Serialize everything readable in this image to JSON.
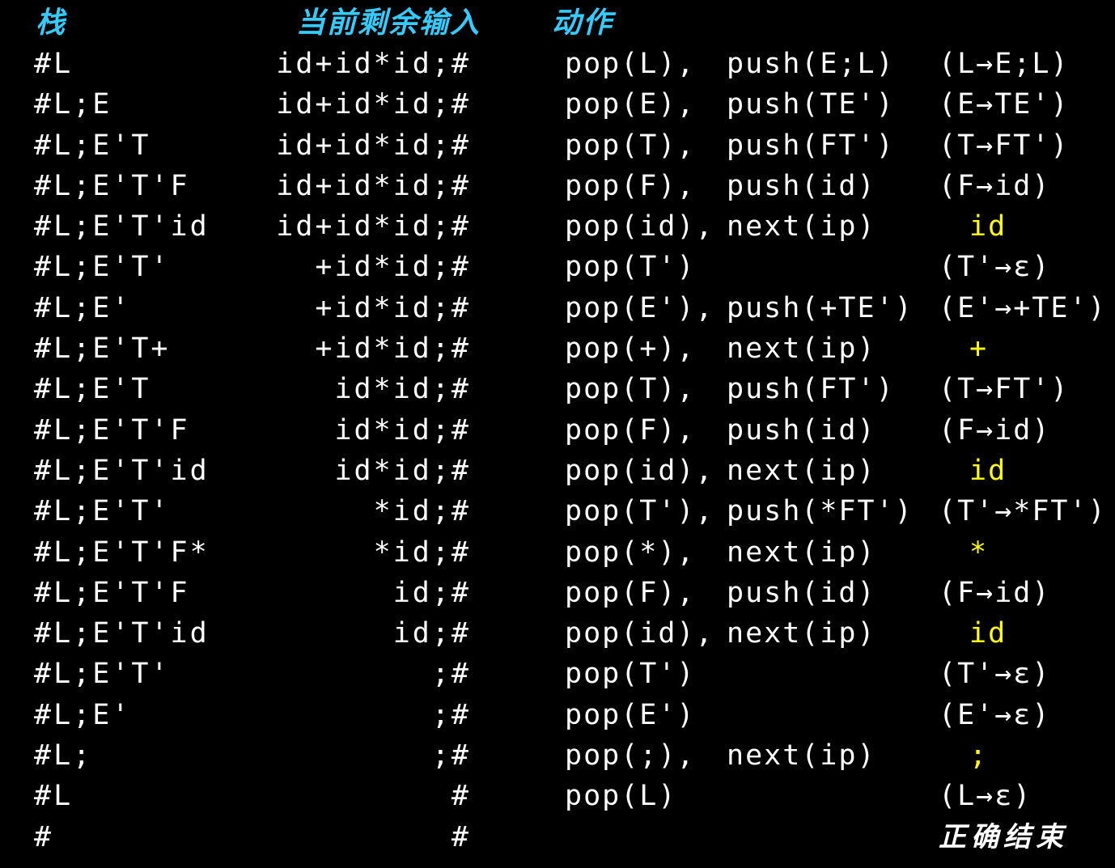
{
  "headers": {
    "stack": "栈",
    "input": "当前剩余输入",
    "action": "动作"
  },
  "rows": [
    {
      "stack": "#L",
      "input": "id+id*id;#",
      "pop": "pop(L),",
      "push": "push(E;L)",
      "note": "(L→E;L)",
      "note_color": "white"
    },
    {
      "stack": "#L;E",
      "input": "id+id*id;#",
      "pop": "pop(E),",
      "push": "push(TE')",
      "note": "(E→TE')",
      "note_color": "white"
    },
    {
      "stack": "#L;E'T",
      "input": "id+id*id;#",
      "pop": "pop(T),",
      "push": "push(FT')",
      "note": "(T→FT')",
      "note_color": "white"
    },
    {
      "stack": "#L;E'T'F",
      "input": "id+id*id;#",
      "pop": "pop(F),",
      "push": "push(id)",
      "note": "(F→id)",
      "note_color": "white"
    },
    {
      "stack": "#L;E'T'id",
      "input": "id+id*id;#",
      "pop": "pop(id),",
      "push": "next(ip)",
      "note": "id",
      "note_color": "yellow"
    },
    {
      "stack": "#L;E'T'",
      "input": "+id*id;#",
      "pop": "pop(T')",
      "push": "",
      "note": "(T'→ε)",
      "note_color": "white"
    },
    {
      "stack": "#L;E'",
      "input": "+id*id;#",
      "pop": "pop(E'),",
      "push": "push(+TE')",
      "note": "(E'→+TE')",
      "note_color": "white"
    },
    {
      "stack": "#L;E'T+",
      "input": "+id*id;#",
      "pop": "pop(+),",
      "push": "next(ip)",
      "note": "+",
      "note_color": "yellow"
    },
    {
      "stack": "#L;E'T",
      "input": "id*id;#",
      "pop": "pop(T),",
      "push": "push(FT')",
      "note": "(T→FT')",
      "note_color": "white"
    },
    {
      "stack": "#L;E'T'F",
      "input": "id*id;#",
      "pop": "pop(F),",
      "push": "push(id)",
      "note": "(F→id)",
      "note_color": "white"
    },
    {
      "stack": "#L;E'T'id",
      "input": "id*id;#",
      "pop": "pop(id),",
      "push": "next(ip)",
      "note": "id",
      "note_color": "yellow"
    },
    {
      "stack": "#L;E'T'",
      "input": "*id;#",
      "pop": "pop(T'),",
      "push": "push(*FT')",
      "note": "(T'→*FT')",
      "note_color": "white"
    },
    {
      "stack": "#L;E'T'F*",
      "input": "*id;#",
      "pop": "pop(*),",
      "push": "next(ip)",
      "note": "*",
      "note_color": "yellow"
    },
    {
      "stack": "#L;E'T'F",
      "input": "id;#",
      "pop": "pop(F),",
      "push": "push(id)",
      "note": "(F→id)",
      "note_color": "white"
    },
    {
      "stack": "#L;E'T'id",
      "input": "id;#",
      "pop": "pop(id),",
      "push": "next(ip)",
      "note": "id",
      "note_color": "yellow"
    },
    {
      "stack": "#L;E'T'",
      "input": ";#",
      "pop": "pop(T')",
      "push": "",
      "note": "(T'→ε)",
      "note_color": "white"
    },
    {
      "stack": "#L;E'",
      "input": ";#",
      "pop": "pop(E')",
      "push": "",
      "note": "(E'→ε)",
      "note_color": "white"
    },
    {
      "stack": "#L;",
      "input": ";#",
      "pop": "pop(;),",
      "push": "next(ip)",
      "note": ";",
      "note_color": "yellow"
    },
    {
      "stack": "#L",
      "input": "#",
      "pop": "pop(L)",
      "push": "",
      "note": "(L→ε)",
      "note_color": "white"
    },
    {
      "stack": "#",
      "input": "#",
      "pop": "",
      "push": "",
      "note": "正确结束",
      "note_color": "final"
    }
  ],
  "colors": {
    "background": "#000000",
    "text": "#ffffff",
    "header": "#33ccff",
    "highlight": "#ffff00"
  }
}
